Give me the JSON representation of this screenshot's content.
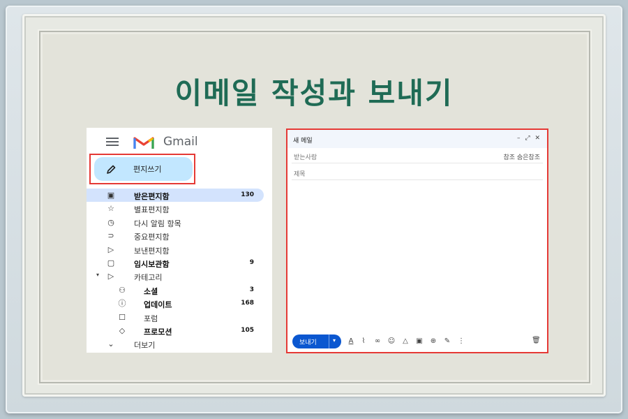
{
  "title": "이메일 작성과 보내기",
  "sidebar": {
    "brand": "Gmail",
    "compose_label": "편지쓰기",
    "items": [
      {
        "label": "받은편지함",
        "count": "130",
        "icon": "inbox-icon",
        "glyph": "▣",
        "bold": true,
        "active": true
      },
      {
        "label": "별표편지함",
        "count": "",
        "icon": "star-icon",
        "glyph": "☆",
        "bold": false,
        "active": false
      },
      {
        "label": "다시 알림 항목",
        "count": "",
        "icon": "clock-icon",
        "glyph": "◷",
        "bold": false,
        "active": false
      },
      {
        "label": "중요편지함",
        "count": "",
        "icon": "important-icon",
        "glyph": "⊃",
        "bold": false,
        "active": false
      },
      {
        "label": "보낸편지함",
        "count": "",
        "icon": "send-icon",
        "glyph": "▷",
        "bold": false,
        "active": false
      },
      {
        "label": "임시보관함",
        "count": "9",
        "icon": "draft-icon",
        "glyph": "▢",
        "bold": true,
        "active": false
      },
      {
        "label": "카테고리",
        "count": "",
        "icon": "label-icon",
        "glyph": "▷",
        "bold": false,
        "active": false
      }
    ],
    "categories": [
      {
        "label": "소셜",
        "count": "3",
        "icon": "people-icon",
        "glyph": "⚇",
        "bold": true
      },
      {
        "label": "업데이트",
        "count": "168",
        "icon": "info-icon",
        "glyph": "ⓘ",
        "bold": true
      },
      {
        "label": "포럼",
        "count": "",
        "icon": "forum-icon",
        "glyph": "☐",
        "bold": false
      },
      {
        "label": "프로모션",
        "count": "105",
        "icon": "tag-icon",
        "glyph": "◇",
        "bold": true
      }
    ],
    "more_label": "더보기"
  },
  "compose": {
    "title": "새 메일",
    "controls": "– ⤢ ✕",
    "to_label": "받는사람",
    "cc_bcc": "참조 숨은참조",
    "subject_label": "제목",
    "send_label": "보내기"
  },
  "colors": {
    "title": "#1f6b55",
    "compose_button": "#c2e7ff",
    "inbox_active": "#d3e3fd",
    "send_button": "#0b57d0",
    "highlight_border": "#e53935"
  }
}
